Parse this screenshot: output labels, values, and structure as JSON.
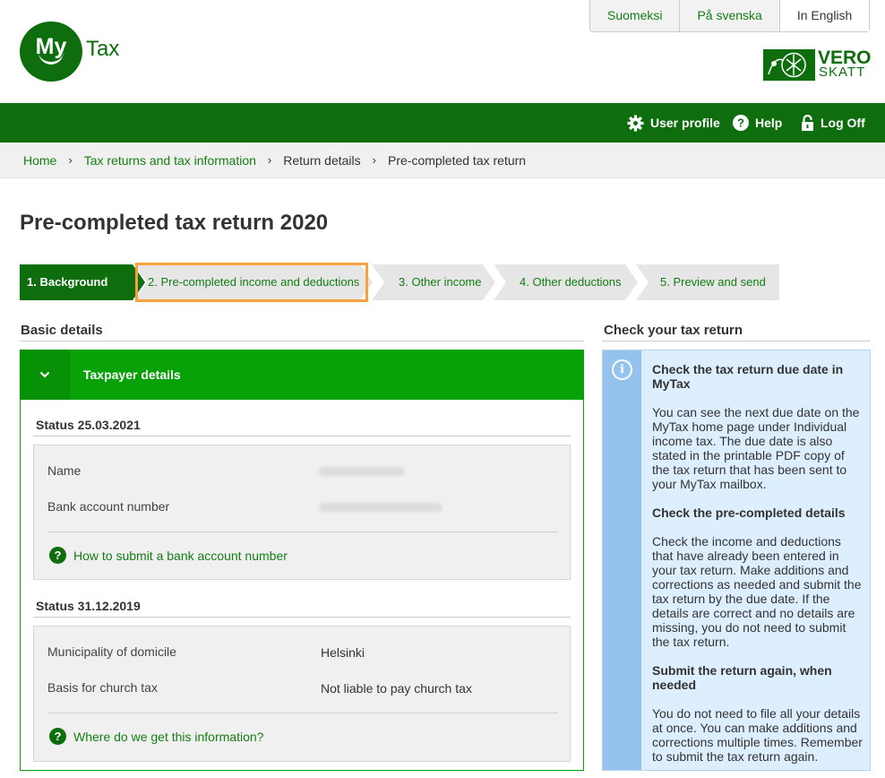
{
  "header": {
    "logo": {
      "main": "My",
      "suffix": "Tax"
    },
    "languages": [
      "Suomeksi",
      "På svenska",
      "In English"
    ],
    "vero_logo": {
      "line1": "VERO",
      "line2": "SKATT"
    }
  },
  "nav": {
    "user_profile": "User profile",
    "help": "Help",
    "log_off": "Log Off"
  },
  "breadcrumb": [
    "Home",
    "Tax returns and tax information",
    "Return details",
    "Pre-completed tax return"
  ],
  "page_title": "Pre-completed tax return 2020",
  "steps": [
    {
      "label": "1. Background",
      "state": "active"
    },
    {
      "label": "2. Pre-completed income and deductions",
      "state": "inactive"
    },
    {
      "label": "3. Other income",
      "state": "inactive"
    },
    {
      "label": "4. Other deductions",
      "state": "inactive"
    },
    {
      "label": "5. Preview and send",
      "state": "inactive"
    }
  ],
  "basic_details": {
    "heading": "Basic details",
    "panel_title": "Taxpayer details",
    "section1": {
      "status": "Status 25.03.2021",
      "rows": [
        {
          "label": "Name",
          "value": ""
        },
        {
          "label": "Bank account number",
          "value": ""
        }
      ],
      "help_link": "How to submit a bank account number"
    },
    "section2": {
      "status": "Status 31.12.2019",
      "rows": [
        {
          "label": "Municipality of domicile",
          "value": "Helsinki"
        },
        {
          "label": "Basis for church tax",
          "value": "Not liable to pay church tax"
        }
      ],
      "help_link": "Where do we get this information?"
    }
  },
  "check_return": {
    "heading": "Check your tax return",
    "blocks": [
      {
        "title": "Check the tax return due date in MyTax",
        "text": "You can see the next due date on the MyTax home page under Individual income tax. The due date is also stated in the printable PDF copy of the tax return that has been sent to your MyTax mailbox."
      },
      {
        "title": "Check the pre-completed details",
        "text": "Check the income and deductions that have already been entered in your tax return. Make additions and corrections as needed and submit the tax return by the due date. If the details are correct and no details are missing, you do not need to submit the tax return."
      },
      {
        "title": "Submit the return again, when needed",
        "text": "You do not need to file all your details at once. You can make additions and corrections multiple times. Remember to submit the tax return again."
      }
    ]
  },
  "colors": {
    "brand_green": "#0e6e0e",
    "panel_green": "#08a108",
    "highlight_orange": "#f7a23d",
    "info_blue": "#ddeeff"
  }
}
